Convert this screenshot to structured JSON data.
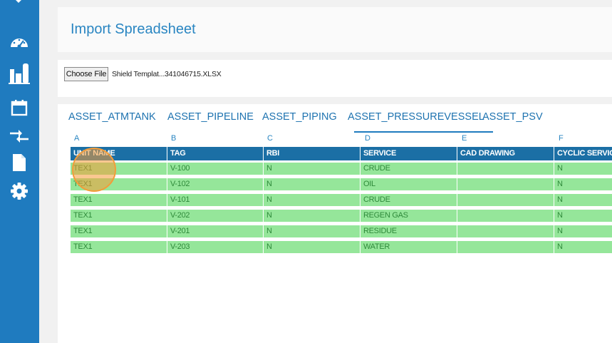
{
  "page": {
    "title": "Import Spreadsheet"
  },
  "sidebar": {
    "items": [
      {
        "icon": "dashboard-gauge-icon"
      },
      {
        "icon": "assets-plant-icon"
      },
      {
        "icon": "calendar-icon"
      },
      {
        "icon": "transfer-arrows-icon"
      },
      {
        "icon": "document-icon"
      },
      {
        "icon": "settings-gear-icon"
      }
    ]
  },
  "file_input": {
    "button_label": "Choose File",
    "file_name": "Shield Templat...341046715.XLSX"
  },
  "tabs": [
    {
      "label": "ASSET_ATMTANK",
      "active": false
    },
    {
      "label": "ASSET_PIPELINE",
      "active": false
    },
    {
      "label": "ASSET_PIPING",
      "active": false
    },
    {
      "label": "ASSET_PRESSUREVESSEL",
      "active": true
    },
    {
      "label": "ASSET_PSV",
      "active": false
    }
  ],
  "grid": {
    "column_letters": [
      "A",
      "B",
      "C",
      "D",
      "E",
      "F"
    ],
    "headers": [
      "UNIT NAME",
      "TAG",
      "RBI",
      "SERVICE",
      "CAD DRAWING",
      "CYCLIC SERVICE"
    ],
    "rows": [
      [
        "TEX1",
        "V-100",
        "N",
        "CRUDE",
        "",
        "N"
      ],
      [
        "TEX1",
        "V-102",
        "N",
        "OIL",
        "",
        "N"
      ],
      [
        "TEX1",
        "V-101",
        "N",
        "CRUDE",
        "",
        "N"
      ],
      [
        "TEX1",
        "V-202",
        "N",
        "REGEN GAS",
        "",
        "N"
      ],
      [
        "TEX1",
        "V-201",
        "N",
        "RESIDUE",
        "",
        "N"
      ],
      [
        "TEX1",
        "V-203",
        "N",
        "WATER",
        "",
        "N"
      ]
    ]
  },
  "colors": {
    "sidebar": "#1f7bbf",
    "header_row": "#1b6fa5",
    "data_row": "#95e69a",
    "accent": "#2a86c2"
  }
}
